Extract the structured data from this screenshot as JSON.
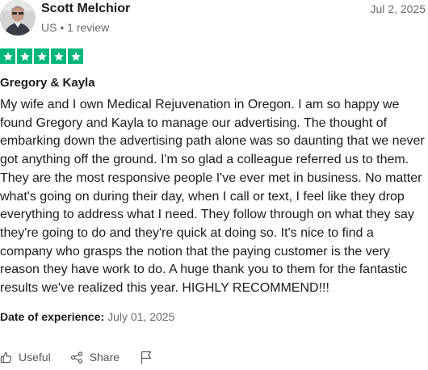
{
  "reviewer": {
    "name": "Scott Melchior",
    "country": "US",
    "separator": "•",
    "review_count": "1 review"
  },
  "review": {
    "date": "Jul 2, 2025",
    "rating": 5,
    "rating_max": 5,
    "star_color": "#00b67a",
    "title": "Gregory & Kayla",
    "body": "My wife and I own Medical Rejuvenation in Oregon. I am so happy we found Gregory and Kayla to manage our advertising. The thought of embarking down the advertising path alone was so daunting that we never got anything off the ground. I'm so glad a colleague referred us to them. They are the most responsive people I've ever met in business. No matter what's going on during their day, when I call or text, I feel like they drop everything to address what I need. They follow through on what they say they're going to do and they're quick at doing so. It's nice to find a company who grasps the notion that the paying customer is the very reason they have work to do. A huge thank you to them for the fantastic results we've realized this year. HIGHLY RECOMMEND!!!",
    "experience_label": "Date of experience:",
    "experience_date": "July 01, 2025"
  },
  "actions": {
    "useful_label": "Useful",
    "useful_icon": "thumbs-up-icon",
    "share_label": "Share",
    "share_icon": "share-icon",
    "report_icon": "flag-icon"
  }
}
